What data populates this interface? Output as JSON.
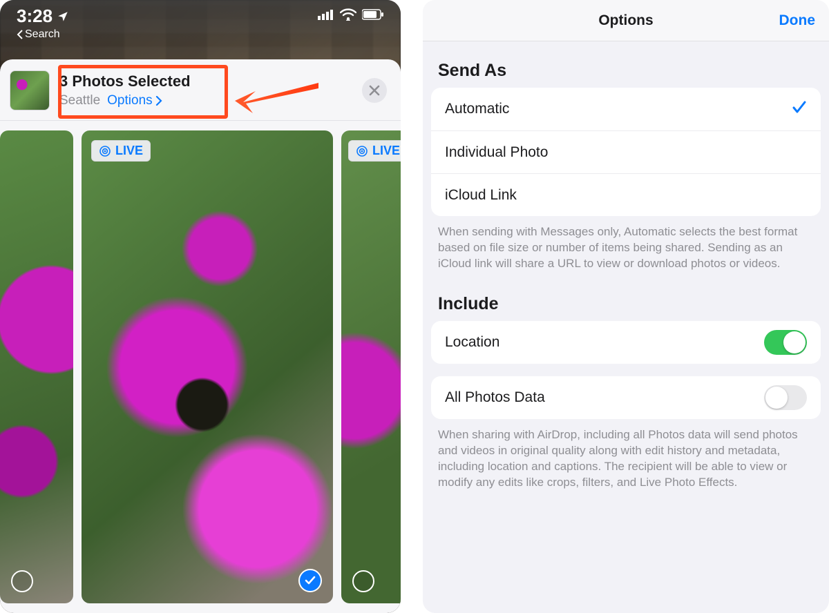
{
  "left": {
    "statusbar": {
      "time": "3:28",
      "back_label": "Search"
    },
    "share_header": {
      "title": "3 Photos Selected",
      "location": "Seattle",
      "options_label": "Options"
    },
    "photos": {
      "live_badge": "LIVE"
    }
  },
  "right": {
    "nav": {
      "title": "Options",
      "done": "Done"
    },
    "send_as": {
      "header": "Send As",
      "items": [
        {
          "label": "Automatic",
          "selected": true
        },
        {
          "label": "Individual Photo",
          "selected": false
        },
        {
          "label": "iCloud Link",
          "selected": false
        }
      ],
      "footer": "When sending with Messages only, Automatic selects the best format based on file size or number of items being shared. Sending as an iCloud link will share a URL to view or download photos or videos."
    },
    "include": {
      "header": "Include",
      "location": {
        "label": "Location",
        "on": true
      },
      "all_data": {
        "label": "All Photos Data",
        "on": false
      },
      "footer": "When sharing with AirDrop, including all Photos data will send photos and videos in original quality along with edit history and metadata, including location and captions. The recipient will be able to view or modify any edits like crops, filters, and Live Photo Effects."
    }
  }
}
